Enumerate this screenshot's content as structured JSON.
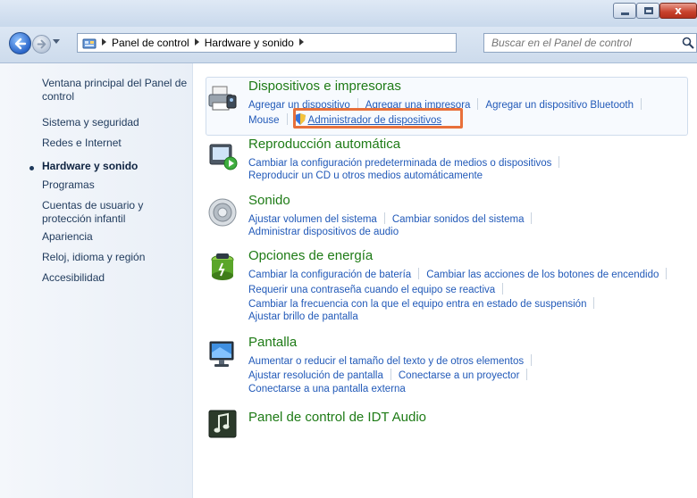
{
  "window": {
    "minimize_label": "",
    "maximize_label": "",
    "close_label": "x"
  },
  "address_bar": {
    "crumbs": [
      "Panel de control",
      "Hardware y sonido"
    ],
    "search_placeholder": "Buscar en el Panel de control"
  },
  "sidebar": {
    "items": [
      {
        "label": "Ventana principal del Panel de control"
      },
      {
        "label": "Sistema y seguridad"
      },
      {
        "label": "Redes e Internet"
      },
      {
        "label": "Hardware y sonido",
        "current": true
      },
      {
        "label": "Programas"
      },
      {
        "label": "Cuentas de usuario y protección infantil"
      },
      {
        "label": "Apariencia"
      },
      {
        "label": "Reloj, idioma y región"
      },
      {
        "label": "Accesibilidad"
      }
    ]
  },
  "categories": [
    {
      "title": "Dispositivos e impresoras",
      "icon": "printer-icon",
      "links": [
        [
          "Agregar un dispositivo",
          "Agregar una impresora",
          "Agregar un dispositivo Bluetooth"
        ],
        [
          "Mouse",
          "Administrador de dispositivos"
        ]
      ]
    },
    {
      "title": "Reproducción automática",
      "icon": "autoplay-icon",
      "links": [
        [
          "Cambiar la configuración predeterminada de medios o dispositivos"
        ],
        [
          "Reproducir un CD u otros medios automáticamente"
        ]
      ]
    },
    {
      "title": "Sonido",
      "icon": "speaker-icon",
      "links": [
        [
          "Ajustar volumen del sistema",
          "Cambiar sonidos del sistema"
        ],
        [
          "Administrar dispositivos de audio"
        ]
      ]
    },
    {
      "title": "Opciones de energía",
      "icon": "battery-icon",
      "links": [
        [
          "Cambiar la configuración de batería",
          "Cambiar las acciones de los botones de encendido"
        ],
        [
          "Requerir una contraseña cuando el equipo se reactiva"
        ],
        [
          "Cambiar la frecuencia con la que el equipo entra en estado de suspensión"
        ],
        [
          "Ajustar brillo de pantalla"
        ]
      ]
    },
    {
      "title": "Pantalla",
      "icon": "monitor-icon",
      "links": [
        [
          "Aumentar o reducir el tamaño del texto y de otros elementos"
        ],
        [
          "Ajustar resolución de pantalla",
          "Conectarse a un proyector"
        ],
        [
          "Conectarse a una pantalla externa"
        ]
      ]
    },
    {
      "title": "Panel de control de IDT Audio",
      "icon": "music-note-icon",
      "links": []
    }
  ],
  "colors": {
    "category_title": "#1e7b16",
    "link": "#2159b8",
    "highlight": "#e8703a"
  }
}
